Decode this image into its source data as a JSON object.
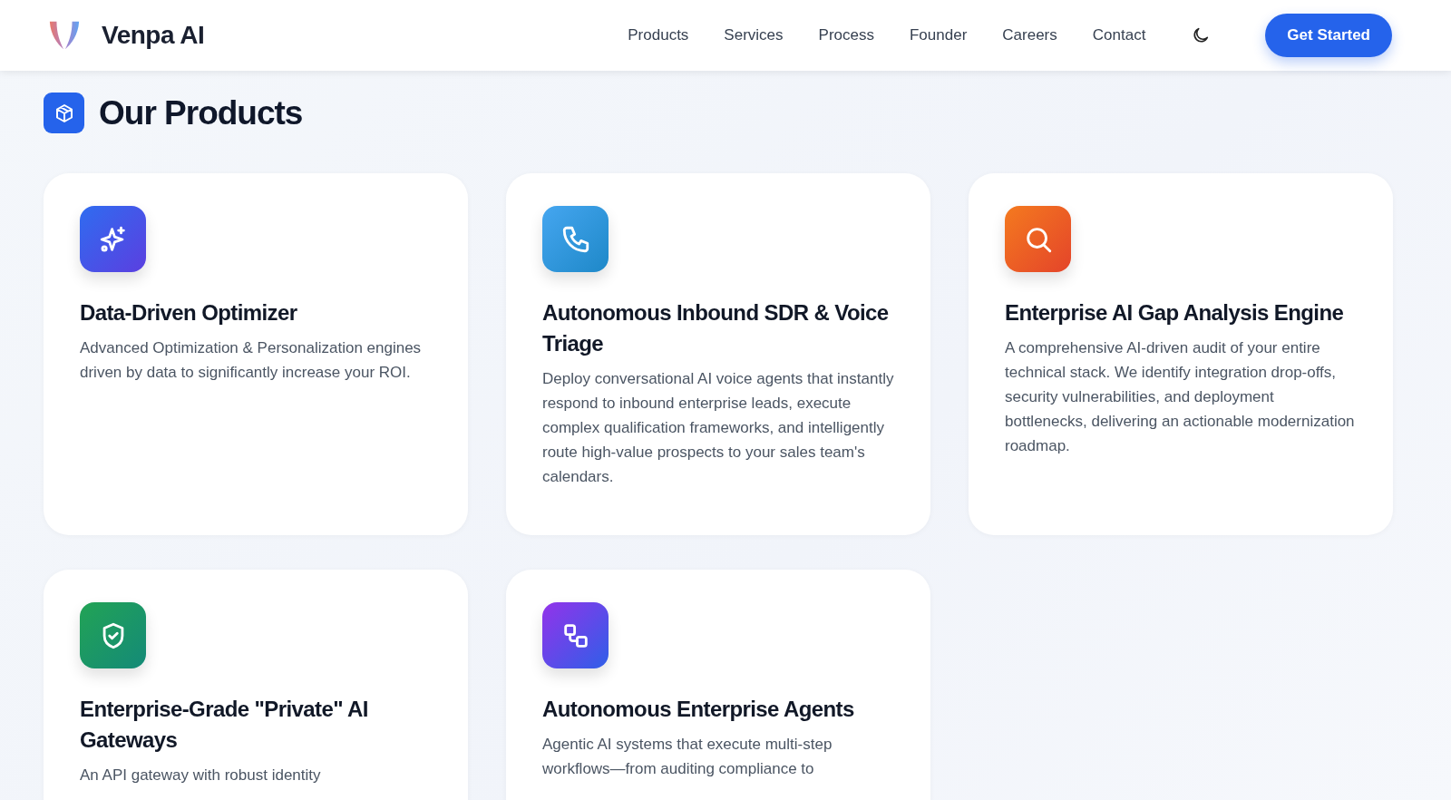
{
  "header": {
    "brand": "Venpa AI",
    "nav": [
      {
        "label": "Products"
      },
      {
        "label": "Services"
      },
      {
        "label": "Process"
      },
      {
        "label": "Founder"
      },
      {
        "label": "Careers"
      },
      {
        "label": "Contact"
      }
    ],
    "cta": "Get Started"
  },
  "section": {
    "title": "Our Products",
    "products": [
      {
        "kind": "sparkles",
        "title": "Data-Driven Optimizer",
        "description": "Advanced Optimization & Personalization engines driven by data to significantly increase your ROI."
      },
      {
        "kind": "phone",
        "title": "Autonomous Inbound SDR & Voice Triage",
        "description": "Deploy conversational AI voice agents that instantly respond to inbound enterprise leads, execute complex qualification frameworks, and intelligently route high-value prospects to your sales team's calendars."
      },
      {
        "kind": "search",
        "title": "Enterprise AI Gap Analysis Engine",
        "description": "A comprehensive AI-driven audit of your entire technical stack. We identify integration drop-offs, security vulnerabilities, and deployment bottlenecks, delivering an actionable modernization roadmap."
      },
      {
        "kind": "shield",
        "title": "Enterprise-Grade \"Private\" AI Gateways",
        "description": "An API gateway with robust identity"
      },
      {
        "kind": "workflow",
        "title": "Autonomous Enterprise Agents",
        "description": "Agentic AI systems that execute multi-step workflows—from auditing compliance to"
      }
    ]
  }
}
